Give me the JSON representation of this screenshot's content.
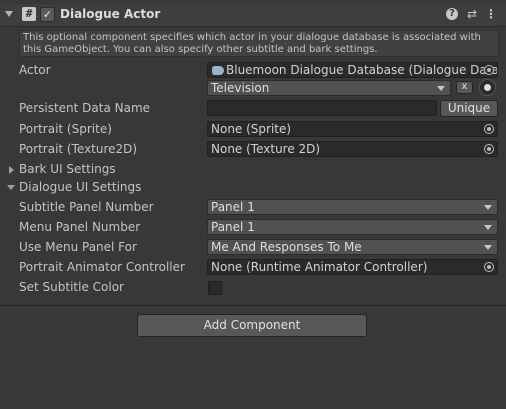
{
  "component": {
    "title": "Dialogue Actor",
    "icon": "script-icon",
    "enabled_mark": "✓",
    "help_glyph": "?",
    "presets_glyph": "⇄",
    "menu_glyph": "⋮"
  },
  "help_text": "This optional component specifies which actor in your dialogue database is associated with this GameObject. You can also specify other subtitle and bark settings.",
  "actor": {
    "label": "Actor",
    "database_value": "Bluemoon Dialogue Database (Dialogue Datab",
    "actor_value": "Television",
    "clear_label": "x"
  },
  "persistent": {
    "label": "Persistent Data Name",
    "value": "",
    "unique_label": "Unique"
  },
  "portrait_sprite": {
    "label": "Portrait (Sprite)",
    "value": "None (Sprite)"
  },
  "portrait_texture": {
    "label": "Portrait (Texture2D)",
    "value": "None (Texture 2D)"
  },
  "bark_ui": {
    "label": "Bark UI Settings",
    "expanded": false
  },
  "dialogue_ui": {
    "label": "Dialogue UI Settings",
    "expanded": true
  },
  "subtitle_panel": {
    "label": "Subtitle Panel Number",
    "value": "Panel 1"
  },
  "menu_panel": {
    "label": "Menu Panel Number",
    "value": "Panel 1"
  },
  "use_menu_panel": {
    "label": "Use Menu Panel For",
    "value": "Me And Responses To Me"
  },
  "portrait_animator": {
    "label": "Portrait Animator Controller",
    "value": "None (Runtime Animator Controller)"
  },
  "subtitle_color": {
    "label": "Set Subtitle Color",
    "checked": false
  },
  "add_component_label": "Add Component",
  "colors": {
    "background": "#383838",
    "field": "#2a2a2a",
    "dropdown": "#515151",
    "button": "#585858",
    "text": "#c4c4c4"
  }
}
